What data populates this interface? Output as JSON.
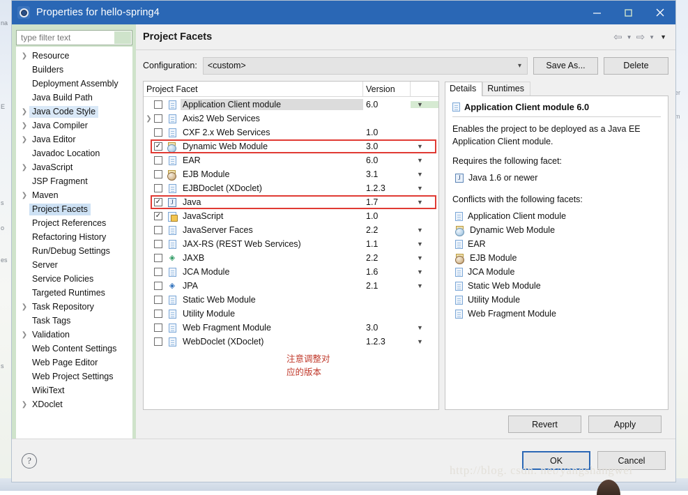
{
  "window": {
    "title": "Properties for hello-spring4",
    "icon": "gear-icon",
    "minimize_label": "—",
    "maximize_label": "□",
    "close_label": "✕"
  },
  "sidebar": {
    "filter": {
      "value": "",
      "placeholder": "type filter text"
    },
    "items": [
      {
        "label": "Resource",
        "expandable": true,
        "state": "normal"
      },
      {
        "label": "Builders",
        "expandable": false,
        "state": "normal"
      },
      {
        "label": "Deployment Assembly",
        "expandable": false,
        "state": "normal"
      },
      {
        "label": "Java Build Path",
        "expandable": false,
        "state": "normal"
      },
      {
        "label": "Java Code Style",
        "expandable": true,
        "state": "hover"
      },
      {
        "label": "Java Compiler",
        "expandable": true,
        "state": "normal"
      },
      {
        "label": "Java Editor",
        "expandable": true,
        "state": "normal"
      },
      {
        "label": "Javadoc Location",
        "expandable": false,
        "state": "normal"
      },
      {
        "label": "JavaScript",
        "expandable": true,
        "state": "normal"
      },
      {
        "label": "JSP Fragment",
        "expandable": false,
        "state": "normal"
      },
      {
        "label": "Maven",
        "expandable": true,
        "state": "normal"
      },
      {
        "label": "Project Facets",
        "expandable": false,
        "state": "selected"
      },
      {
        "label": "Project References",
        "expandable": false,
        "state": "normal"
      },
      {
        "label": "Refactoring History",
        "expandable": false,
        "state": "normal"
      },
      {
        "label": "Run/Debug Settings",
        "expandable": false,
        "state": "normal"
      },
      {
        "label": "Server",
        "expandable": false,
        "state": "normal"
      },
      {
        "label": "Service Policies",
        "expandable": false,
        "state": "normal"
      },
      {
        "label": "Targeted Runtimes",
        "expandable": false,
        "state": "normal"
      },
      {
        "label": "Task Repository",
        "expandable": true,
        "state": "normal"
      },
      {
        "label": "Task Tags",
        "expandable": false,
        "state": "normal"
      },
      {
        "label": "Validation",
        "expandable": true,
        "state": "normal"
      },
      {
        "label": "Web Content Settings",
        "expandable": false,
        "state": "normal"
      },
      {
        "label": "Web Page Editor",
        "expandable": false,
        "state": "normal"
      },
      {
        "label": "Web Project Settings",
        "expandable": false,
        "state": "normal"
      },
      {
        "label": "WikiText",
        "expandable": false,
        "state": "normal"
      },
      {
        "label": "XDoclet",
        "expandable": true,
        "state": "normal"
      }
    ]
  },
  "main": {
    "page_title": "Project Facets",
    "nav": {
      "back_icon": "back-arrow-icon",
      "back_chevron": "chevron-down-icon",
      "forward_icon": "forward-arrow-icon",
      "forward_chevron": "chevron-down-icon",
      "menu_chevron": "chevron-down-icon"
    },
    "configuration": {
      "label": "Configuration:",
      "value": "<custom>",
      "chevron": "chevron-down-icon",
      "save_as_label": "Save As...",
      "delete_label": "Delete"
    },
    "facet_table": {
      "columns": [
        "Project Facet",
        "Version"
      ],
      "rows": [
        {
          "name": "Application Client module",
          "version": "6.0",
          "checked": false,
          "expandable": false,
          "icon": "doc-icon",
          "dropdown": true,
          "name_highlight": true,
          "dropdown_highlight": true,
          "red_outline": false
        },
        {
          "name": "Axis2 Web Services",
          "version": "",
          "checked": false,
          "expandable": true,
          "icon": "doc-icon",
          "dropdown": false,
          "name_highlight": false,
          "dropdown_highlight": false,
          "red_outline": false
        },
        {
          "name": "CXF 2.x Web Services",
          "version": "1.0",
          "checked": false,
          "expandable": false,
          "icon": "doc-icon",
          "dropdown": false,
          "name_highlight": false,
          "dropdown_highlight": false,
          "red_outline": false
        },
        {
          "name": "Dynamic Web Module",
          "version": "3.0",
          "checked": true,
          "expandable": false,
          "icon": "web-module-icon",
          "dropdown": true,
          "name_highlight": false,
          "dropdown_highlight": false,
          "red_outline": true
        },
        {
          "name": "EAR",
          "version": "6.0",
          "checked": false,
          "expandable": false,
          "icon": "doc-icon",
          "dropdown": true,
          "name_highlight": false,
          "dropdown_highlight": false,
          "red_outline": false
        },
        {
          "name": "EJB Module",
          "version": "3.1",
          "checked": false,
          "expandable": false,
          "icon": "ejb-module-icon",
          "dropdown": true,
          "name_highlight": false,
          "dropdown_highlight": false,
          "red_outline": false
        },
        {
          "name": "EJBDoclet (XDoclet)",
          "version": "1.2.3",
          "checked": false,
          "expandable": false,
          "icon": "doc-icon",
          "dropdown": true,
          "name_highlight": false,
          "dropdown_highlight": false,
          "red_outline": false
        },
        {
          "name": "Java",
          "version": "1.7",
          "checked": true,
          "expandable": false,
          "icon": "java-icon",
          "dropdown": true,
          "name_highlight": false,
          "dropdown_highlight": false,
          "red_outline": true
        },
        {
          "name": "JavaScript",
          "version": "1.0",
          "checked": true,
          "expandable": false,
          "icon": "javascript-icon",
          "dropdown": false,
          "name_highlight": false,
          "dropdown_highlight": false,
          "red_outline": false
        },
        {
          "name": "JavaServer Faces",
          "version": "2.2",
          "checked": false,
          "expandable": false,
          "icon": "doc-icon",
          "dropdown": true,
          "name_highlight": false,
          "dropdown_highlight": false,
          "red_outline": false
        },
        {
          "name": "JAX-RS (REST Web Services)",
          "version": "1.1",
          "checked": false,
          "expandable": false,
          "icon": "doc-icon",
          "dropdown": true,
          "name_highlight": false,
          "dropdown_highlight": false,
          "red_outline": false
        },
        {
          "name": "JAXB",
          "version": "2.2",
          "checked": false,
          "expandable": false,
          "icon": "jaxb-icon",
          "dropdown": true,
          "name_highlight": false,
          "dropdown_highlight": false,
          "red_outline": false
        },
        {
          "name": "JCA Module",
          "version": "1.6",
          "checked": false,
          "expandable": false,
          "icon": "doc-icon",
          "dropdown": true,
          "name_highlight": false,
          "dropdown_highlight": false,
          "red_outline": false
        },
        {
          "name": "JPA",
          "version": "2.1",
          "checked": false,
          "expandable": false,
          "icon": "jpa-icon",
          "dropdown": true,
          "name_highlight": false,
          "dropdown_highlight": false,
          "red_outline": false
        },
        {
          "name": "Static Web Module",
          "version": "",
          "checked": false,
          "expandable": false,
          "icon": "doc-icon",
          "dropdown": false,
          "name_highlight": false,
          "dropdown_highlight": false,
          "red_outline": false
        },
        {
          "name": "Utility Module",
          "version": "",
          "checked": false,
          "expandable": false,
          "icon": "doc-icon",
          "dropdown": false,
          "name_highlight": false,
          "dropdown_highlight": false,
          "red_outline": false
        },
        {
          "name": "Web Fragment Module",
          "version": "3.0",
          "checked": false,
          "expandable": false,
          "icon": "doc-icon",
          "dropdown": true,
          "name_highlight": false,
          "dropdown_highlight": false,
          "red_outline": false
        },
        {
          "name": "WebDoclet (XDoclet)",
          "version": "1.2.3",
          "checked": false,
          "expandable": false,
          "icon": "doc-icon",
          "dropdown": true,
          "name_highlight": false,
          "dropdown_highlight": false,
          "red_outline": false
        }
      ]
    },
    "annotation": "注意调整对应的版本",
    "details": {
      "tabs": [
        {
          "label": "Details",
          "active": true
        },
        {
          "label": "Runtimes",
          "active": false
        }
      ],
      "title": "Application Client module 6.0",
      "title_icon": "doc-icon",
      "description": "Enables the project to be deployed as a Java EE Application Client module.",
      "requires_heading": "Requires the following facet:",
      "requires": [
        {
          "label": "Java 1.6 or newer",
          "icon": "java-icon"
        }
      ],
      "conflicts_heading": "Conflicts with the following facets:",
      "conflicts": [
        {
          "label": "Application Client module",
          "icon": "doc-icon"
        },
        {
          "label": "Dynamic Web Module",
          "icon": "web-module-icon"
        },
        {
          "label": "EAR",
          "icon": "doc-icon"
        },
        {
          "label": "EJB Module",
          "icon": "ejb-module-icon"
        },
        {
          "label": "JCA Module",
          "icon": "doc-icon"
        },
        {
          "label": "Static Web Module",
          "icon": "doc-icon"
        },
        {
          "label": "Utility Module",
          "icon": "doc-icon"
        },
        {
          "label": "Web Fragment Module",
          "icon": "doc-icon"
        }
      ]
    },
    "revert_label": "Revert",
    "apply_label": "Apply"
  },
  "footer": {
    "help_icon": "help-question-icon",
    "ok_label": "OK",
    "cancel_label": "Cancel"
  },
  "watermark": "http://blog. csdn. net/yangshangwei",
  "colors": {
    "titlebar": "#2a67b5",
    "sidebar_bg": "#cfe3cb",
    "selection": "#cde1f4",
    "red_outline": "#e03a33",
    "annotation": "#c0392b"
  }
}
